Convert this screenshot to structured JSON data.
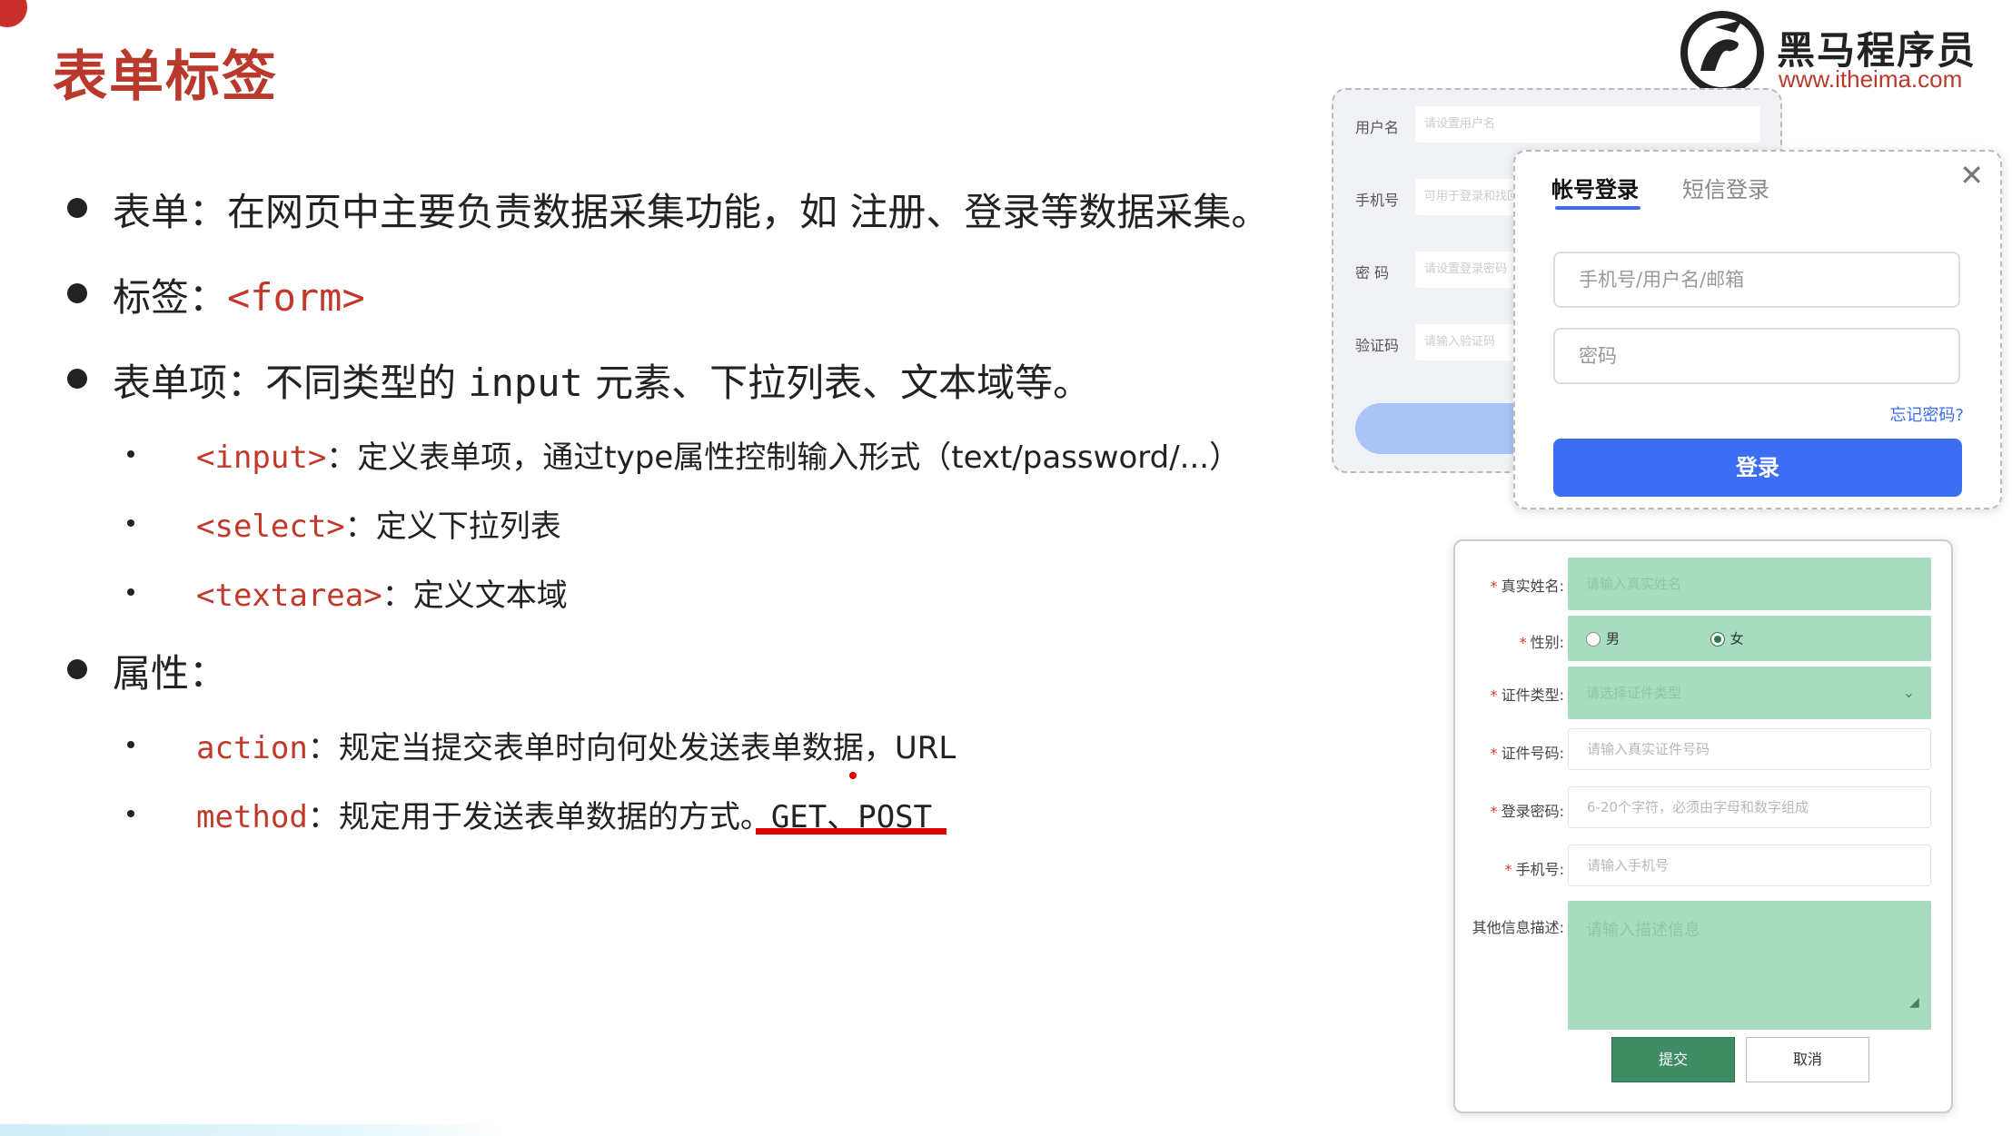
{
  "slide": {
    "title": "表单标签",
    "logo": {
      "name_cn": "黑马程序员",
      "url": "www.itheima.com"
    },
    "bullets": {
      "form": "表单：在网页中主要负责数据采集功能，如 注册、登录等数据采集。",
      "tag_label": "标签：",
      "tag_code": "<form>",
      "items_prefix": "表单项：不同类型的 ",
      "items_code": "input",
      "items_suffix": " 元素、下拉列表、文本域等。",
      "input_code": "<input>",
      "input_desc": "：定义表单项，通过type属性控制输入形式（text/password/...）",
      "select_code": "<select>",
      "select_desc": "：定义下拉列表",
      "textarea_code": "<textarea>",
      "textarea_desc": "：定义文本域",
      "attrs": "属性：",
      "action_code": "action",
      "action_desc": "：规定当提交表单时向何处发送表单数据，URL",
      "method_code": "method",
      "method_desc": "：规定用于发送表单数据的方式。",
      "method_values": "GET、POST"
    }
  },
  "register_form": {
    "fields": [
      {
        "label": "用户名",
        "placeholder": "请设置用户名"
      },
      {
        "label": "手机号",
        "placeholder": "可用于登录和找回"
      },
      {
        "label": "密 码",
        "placeholder": "请设置登录密码"
      },
      {
        "label": "验证码",
        "placeholder": "请输入验证码"
      }
    ]
  },
  "login_card": {
    "tab_account": "帐号登录",
    "tab_sms": "短信登录",
    "close_icon": "close-icon",
    "username_placeholder": "手机号/用户名/邮箱",
    "password_placeholder": "密码",
    "forgot": "忘记密码?",
    "submit": "登录",
    "accent": "#3d6df2"
  },
  "info_form": {
    "name_label": "真实姓名:",
    "name_placeholder": "请输入真实姓名",
    "gender_label": "性别:",
    "gender_male": "男",
    "gender_female": "女",
    "idtype_label": "证件类型:",
    "idtype_placeholder": "请选择证件类型",
    "idnum_label": "证件号码:",
    "idnum_placeholder": "请输入真实证件号码",
    "password_label": "登录密码:",
    "password_placeholder": "6-20个字符，必须由字母和数字组成",
    "phone_label": "手机号:",
    "phone_placeholder": "请输入手机号",
    "desc_label": "其他信息描述:",
    "desc_placeholder": "请输入描述信息",
    "submit": "提交",
    "cancel": "取消",
    "highlight": "#a8dcbf"
  }
}
